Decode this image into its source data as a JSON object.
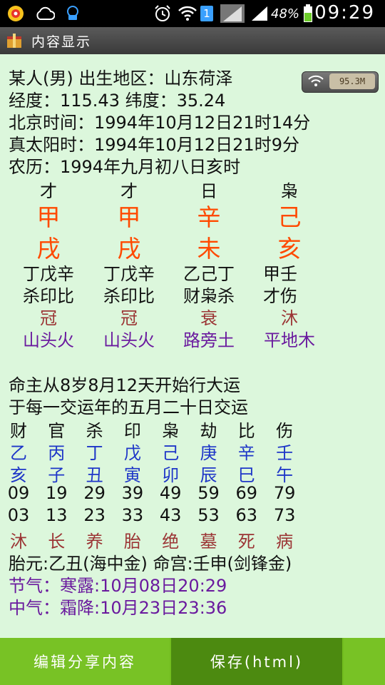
{
  "status": {
    "battery_pct": "48%",
    "sim_badge": "1",
    "time": "09:29"
  },
  "title": "内容显示",
  "net_speed": "95.3M",
  "info_lines": [
    "某人(男) 出生地区：山东荷泽",
    "经度：115.43 纬度：35.24",
    "北京时间：1994年10月12日21时14分",
    "真太阳时：1994年10月12日21时9分",
    "农历：1994年九月初八日亥时"
  ],
  "pillars": [
    {
      "shishen": "才",
      "stem": "甲",
      "branch": "戌",
      "hidden": "丁戊辛",
      "hidden_gods": "杀印比",
      "stage": "冠",
      "nayin": "山头火"
    },
    {
      "shishen": "才",
      "stem": "甲",
      "branch": "戌",
      "hidden": "丁戊辛",
      "hidden_gods": "杀印比",
      "stage": "冠",
      "nayin": "山头火"
    },
    {
      "shishen": "日",
      "stem": "辛",
      "branch": "未",
      "hidden": "乙己丁",
      "hidden_gods": "财枭杀",
      "stage": "衰",
      "nayin": "路旁土"
    },
    {
      "shishen": "枭",
      "stem": "己",
      "branch": "亥",
      "hidden": "甲壬",
      "hidden_gods": "才伤",
      "stage": "沐",
      "nayin": "平地木"
    }
  ],
  "dayun_intro": [
    "命主从8岁8月12天开始行大运",
    "于每一交运年的五月二十日交运"
  ],
  "dayun": {
    "gods": [
      "财",
      "官",
      "杀",
      "印",
      "枭",
      "劫",
      "比",
      "伤"
    ],
    "stems": [
      "乙",
      "丙",
      "丁",
      "戊",
      "己",
      "庚",
      "辛",
      "壬"
    ],
    "branches": [
      "亥",
      "子",
      "丑",
      "寅",
      "卯",
      "辰",
      "巳",
      "午"
    ],
    "ages": [
      "09",
      "19",
      "29",
      "39",
      "49",
      "59",
      "69",
      "79"
    ],
    "years": [
      "03",
      "13",
      "23",
      "33",
      "43",
      "53",
      "63",
      "73"
    ],
    "stages": [
      "沐",
      "长",
      "养",
      "胎",
      "绝",
      "墓",
      "死",
      "病"
    ]
  },
  "taiyuan_line": "胎元:乙丑(海中金) 命宫:壬申(剑锋金)",
  "jieqi_line": "节气：寒露:10月08日20:29",
  "zhongqi_line": "中气：霜降:10月23日23:36",
  "buttons": {
    "edit_share": "编辑分享内容",
    "save_html": "保存(html)"
  },
  "colors": {
    "background": "#dcf7dc",
    "stem_branch": "#ff4a00",
    "stage": "#9b3434",
    "nayin": "#6a1a9e",
    "dayun_ganzhi": "#1e36c8",
    "bottom_bar": "#72bd1e"
  },
  "icons": [
    "notification-flower-icon",
    "cloud-icon",
    "support-chat-icon",
    "alarm-icon",
    "wifi-icon",
    "cell-signal-icon",
    "battery-icon",
    "app-icon",
    "wifi-speed-icon"
  ]
}
